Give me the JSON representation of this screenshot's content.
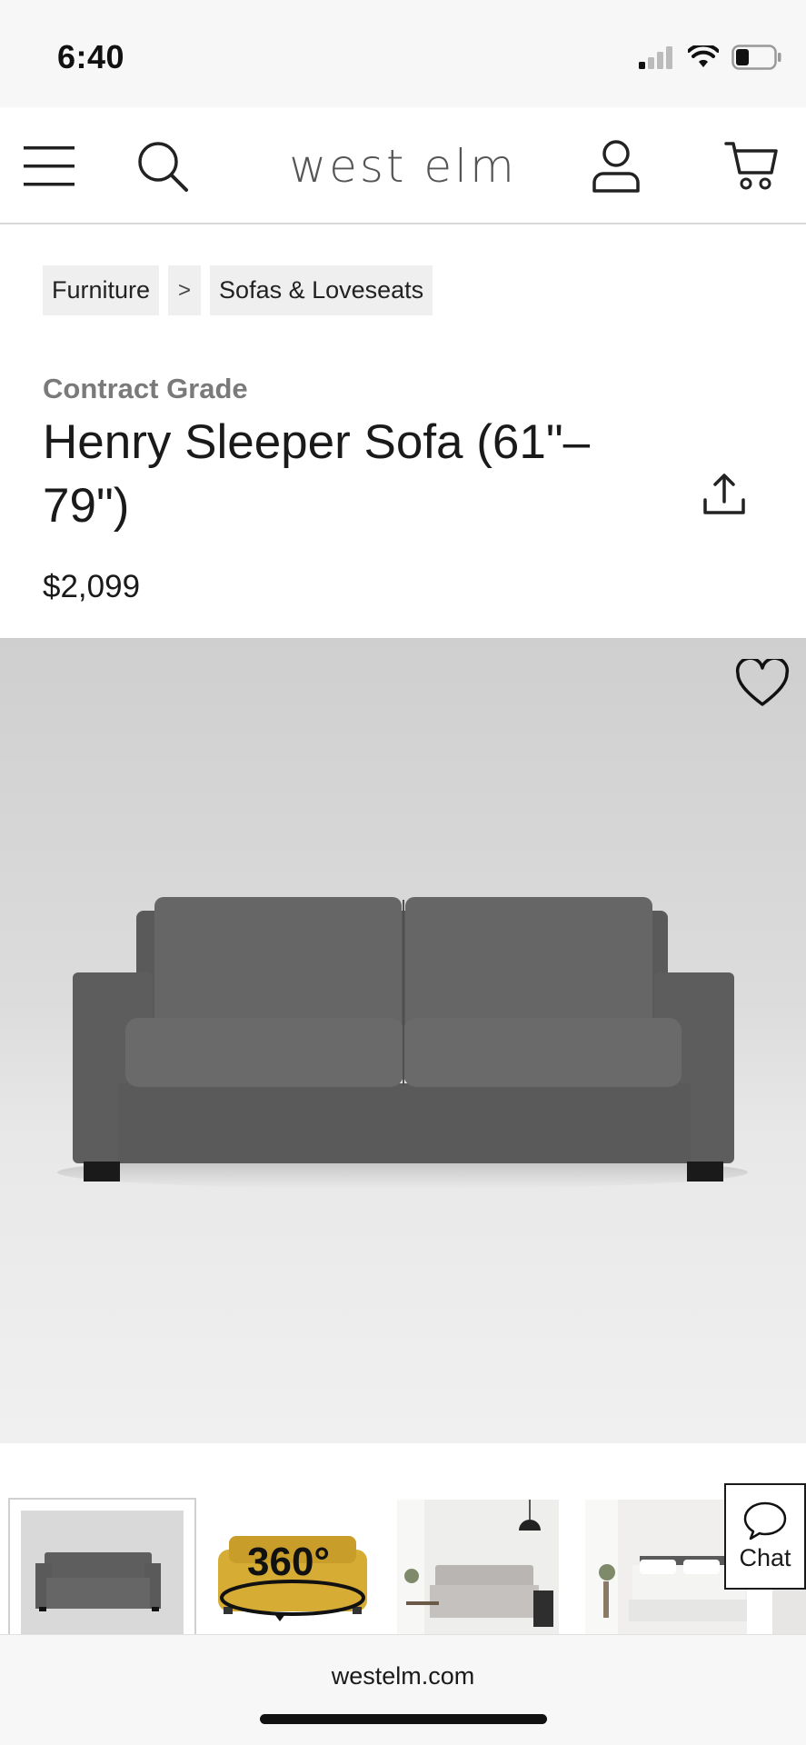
{
  "status_bar": {
    "time": "6:40"
  },
  "header": {
    "brand": "west elm",
    "icons": [
      "menu-icon",
      "search-icon",
      "account-icon",
      "cart-icon"
    ]
  },
  "breadcrumb": {
    "items": [
      "Furniture",
      "Sofas & Loveseats"
    ],
    "separator": ">"
  },
  "product": {
    "tag": "Contract Grade",
    "title": "Henry Sleeper Sofa (61\"–79\")",
    "price": "$2,099",
    "share_icon": "share-icon",
    "favorite_icon": "heart-icon"
  },
  "gallery": {
    "thumbnail_badge": "360°",
    "selected_index": 0
  },
  "chat": {
    "label": "Chat"
  },
  "browser": {
    "url": "westelm.com"
  },
  "colors": {
    "brand_text": "#555555",
    "tag_gray": "#7a7a7a",
    "sofa_gray": "#5f5f5f",
    "mustard": "#d6ac34"
  }
}
